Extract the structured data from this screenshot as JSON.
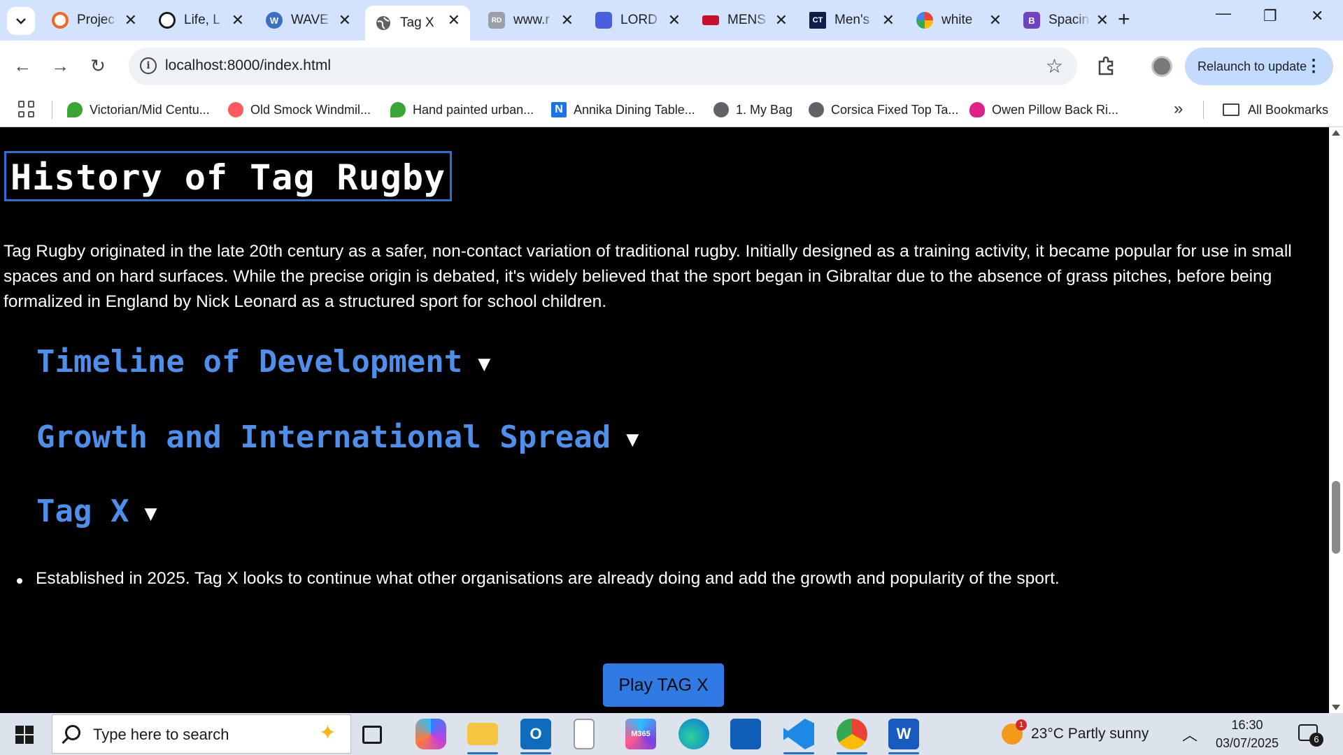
{
  "browser": {
    "tabs": [
      {
        "title": "Projec",
        "favicon_color": "#f26522",
        "favicon_name": "opera-icon",
        "active": false
      },
      {
        "title": "Life, L",
        "favicon_color": "#1a1a1a",
        "favicon_name": "openai-icon",
        "active": false
      },
      {
        "title": "WAVE",
        "favicon_color": "#3a6fc4",
        "favicon_name": "wordpress-icon",
        "active": false
      },
      {
        "title": "Tag X",
        "favicon_color": "#5f6368",
        "favicon_name": "globe-icon",
        "active": true
      },
      {
        "title": "www.r",
        "favicon_color": "#9aa0a6",
        "favicon_name": "rd-icon",
        "active": false
      },
      {
        "title": "LORD",
        "favicon_color": "#4a5fe0",
        "favicon_name": "printer-icon",
        "active": false
      },
      {
        "title": "MENS",
        "favicon_color": "#c8102e",
        "favicon_name": "canterbury-icon",
        "active": false
      },
      {
        "title": "Men's",
        "favicon_color": "#0b1f4a",
        "favicon_name": "ct-icon",
        "active": false
      },
      {
        "title": "white",
        "favicon_color": "#4285f4",
        "favicon_name": "google-lens-icon",
        "active": false
      },
      {
        "title": "Spacin",
        "favicon_color": "#6f42c1",
        "favicon_name": "bootstrap-icon",
        "active": false
      }
    ],
    "favicon_letters": {
      "rd": "RD",
      "ct": "CT",
      "bootstrap": "B"
    },
    "url": "localhost:8000/index.html",
    "relaunch_label": "Relaunch to update",
    "bookmarks": [
      {
        "label": "Victorian/Mid Centu...",
        "icon_color": "#3aa537"
      },
      {
        "label": "Old Smock Windmil...",
        "icon_color": "#ff5a5f"
      },
      {
        "label": "Hand painted urban...",
        "icon_color": "#3aa537"
      },
      {
        "label": "Annika Dining Table...",
        "icon_color": "#1a73e8",
        "icon_letter": "N"
      },
      {
        "label": "1. My Bag",
        "icon_color": "#5f6368"
      },
      {
        "label": "Corsica Fixed Top Ta...",
        "icon_color": "#5f6368"
      },
      {
        "label": "Owen Pillow Back Ri...",
        "icon_color": "#e0218a"
      }
    ],
    "all_bookmarks_label": "All Bookmarks"
  },
  "page": {
    "title": "History of Tag Rugby",
    "intro": "Tag Rugby originated in the late 20th century as a safer, non-contact variation of traditional rugby. Initially designed as a training activity, it became popular for use in small spaces and on hard surfaces. While the precise origin is debated, it's widely believed that the sport began in Gibraltar due to the absence of grass pitches, before being formalized in England by Nick Leonard as a structured sport for school children.",
    "sections": [
      {
        "label": "Timeline of Development",
        "arrow": "▼"
      },
      {
        "label": "Growth and International Spread",
        "arrow": "▼"
      },
      {
        "label": "Tag X",
        "arrow": "▼"
      }
    ],
    "bullets": [
      "Established in 2025. Tag X looks to continue what other organisations are already doing and add the growth and popularity of the sport."
    ],
    "play_button": "Play TAG X",
    "accent_color": "#4d8fea",
    "button_color": "#2f7ae5"
  },
  "taskbar": {
    "search_placeholder": "Type here to search",
    "weather_temp": "23°C",
    "weather_desc": "Partly sunny",
    "weather_badge": "1",
    "time": "16:30",
    "date": "03/07/2025",
    "notification_count": "6",
    "m365_label": "M365"
  }
}
